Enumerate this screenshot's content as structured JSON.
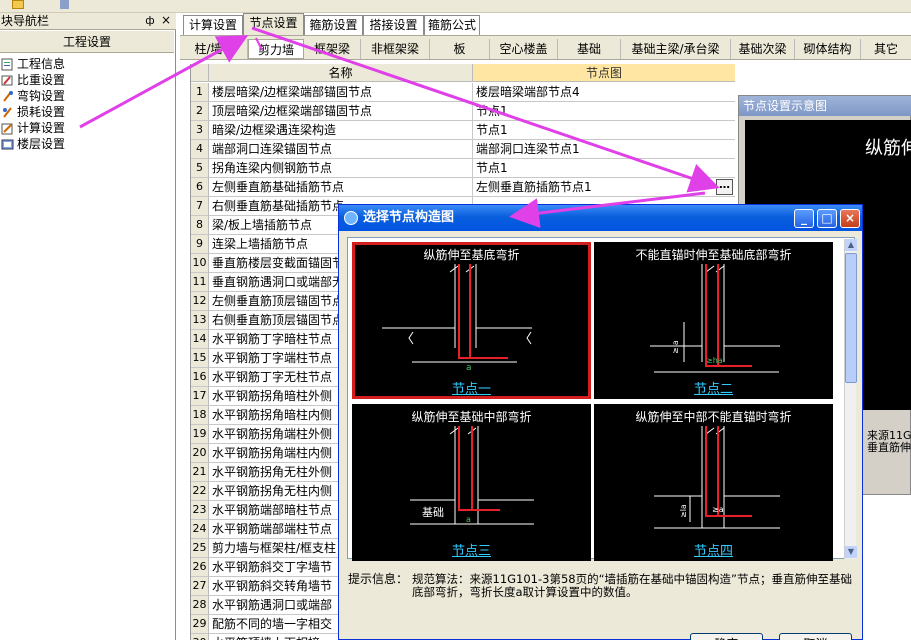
{
  "nav": {
    "title": "块导航栏",
    "pin": "ф",
    "close": "×",
    "section": "工程设置",
    "items": [
      {
        "label": "工程信息",
        "icon": "info-icon"
      },
      {
        "label": "比重设置",
        "icon": "ratio-icon"
      },
      {
        "label": "弯钩设置",
        "icon": "hook-icon"
      },
      {
        "label": "损耗设置",
        "icon": "loss-icon"
      },
      {
        "label": "计算设置",
        "icon": "calc-icon"
      },
      {
        "label": "楼层设置",
        "icon": "floor-icon"
      }
    ]
  },
  "tabs": [
    {
      "label": "计算设置"
    },
    {
      "label": "节点设置"
    },
    {
      "label": "箍筋设置"
    },
    {
      "label": "搭接设置"
    },
    {
      "label": "箍筋公式"
    }
  ],
  "subtabs": [
    {
      "label": "柱/墙柱"
    },
    {
      "label": "剪力墙"
    },
    {
      "label": "框架梁"
    },
    {
      "label": "非框架梁"
    },
    {
      "label": "板"
    },
    {
      "label": "空心楼盖"
    },
    {
      "label": "基础"
    },
    {
      "label": "基础主梁/承台梁"
    },
    {
      "label": "基础次梁"
    },
    {
      "label": "砌体结构"
    },
    {
      "label": "其它"
    }
  ],
  "grid": {
    "headers": {
      "name": "名称",
      "node": "节点图"
    },
    "rows": [
      {
        "num": "1",
        "name": "楼层暗梁/边框梁端部锚固节点",
        "node": "楼层暗梁端部节点4"
      },
      {
        "num": "2",
        "name": "顶层暗梁/边框梁端部锚固节点",
        "node": "节点1"
      },
      {
        "num": "3",
        "name": "暗梁/边框梁遇连梁构造",
        "node": "节点1"
      },
      {
        "num": "4",
        "name": "端部洞口连梁锚固节点",
        "node": "端部洞口连梁节点1"
      },
      {
        "num": "5",
        "name": "拐角连梁内侧钢筋节点",
        "node": "节点1"
      },
      {
        "num": "6",
        "name": "左侧垂直筋基础插筋节点",
        "node": "左侧垂直筋插筋节点1"
      },
      {
        "num": "7",
        "name": "右侧垂直筋基础插筋节点",
        "node": ""
      },
      {
        "num": "8",
        "name": "梁/板上墙插筋节点",
        "node": ""
      },
      {
        "num": "9",
        "name": "连梁上墙插筋节点",
        "node": ""
      },
      {
        "num": "10",
        "name": "垂直筋楼层变截面锚固节",
        "node": ""
      },
      {
        "num": "11",
        "name": "垂直钢筋遇洞口或端部无",
        "node": ""
      },
      {
        "num": "12",
        "name": "左侧垂直筋顶层锚固节点",
        "node": ""
      },
      {
        "num": "13",
        "name": "右侧垂直筋顶层锚固节点",
        "node": ""
      },
      {
        "num": "14",
        "name": "水平钢筋丁字暗柱节点",
        "node": ""
      },
      {
        "num": "15",
        "name": "水平钢筋丁字端柱节点",
        "node": ""
      },
      {
        "num": "16",
        "name": "水平钢筋丁字无柱节点",
        "node": ""
      },
      {
        "num": "17",
        "name": "水平钢筋拐角暗柱外侧",
        "node": ""
      },
      {
        "num": "18",
        "name": "水平钢筋拐角暗柱内侧",
        "node": ""
      },
      {
        "num": "19",
        "name": "水平钢筋拐角端柱外侧",
        "node": ""
      },
      {
        "num": "20",
        "name": "水平钢筋拐角端柱内侧",
        "node": ""
      },
      {
        "num": "21",
        "name": "水平钢筋拐角无柱外侧",
        "node": ""
      },
      {
        "num": "22",
        "name": "水平钢筋拐角无柱内侧",
        "node": ""
      },
      {
        "num": "23",
        "name": "水平钢筋端部暗柱节点",
        "node": ""
      },
      {
        "num": "24",
        "name": "水平钢筋端部端柱节点",
        "node": ""
      },
      {
        "num": "25",
        "name": "剪力墙与框架柱/框支柱",
        "node": ""
      },
      {
        "num": "26",
        "name": "水平钢筋斜交丁字墙节",
        "node": ""
      },
      {
        "num": "27",
        "name": "水平钢筋斜交转角墙节",
        "node": ""
      },
      {
        "num": "28",
        "name": "水平钢筋遇洞口或端部",
        "node": ""
      },
      {
        "num": "29",
        "name": "配筋不同的墙一字相交",
        "node": ""
      },
      {
        "num": "30",
        "name": "水平筋顶墙上下相接",
        "node": ""
      }
    ],
    "ellipsis": "…"
  },
  "preview": {
    "title": "节点设置示意图",
    "heading": "纵筋伸",
    "source_line1": "来源11G",
    "source_line2": "垂直筋伸"
  },
  "dialog": {
    "title": "选择节点构造图",
    "minimize": "_",
    "maximize": "□",
    "close": "×",
    "options": [
      {
        "caption": "纵筋伸至基底弯折",
        "label": "节点一",
        "selected": true
      },
      {
        "caption": "不能直锚时伸至基础底部弯折",
        "label": "节点二",
        "selected": false
      },
      {
        "caption": "纵筋伸至基础中部弯折",
        "label": "节点三",
        "selected": false
      },
      {
        "caption": "纵筋伸至中部不能直锚时弯折",
        "label": "节点四",
        "selected": false
      }
    ],
    "diagram_texts": {
      "a": "a",
      "la": "≥la",
      "ha": "≥ha",
      "base": "基础",
      "ge_a": "≥a"
    },
    "hint_label": "提示信息：",
    "hint_text": "规范算法：来源11G101-3第58页的“墙插筋在基础中锚固构造”节点；垂直筋伸至基础底部弯折，弯折长度a取计算设置中的数值。",
    "ok": "确定",
    "cancel": "取消"
  },
  "colors": {
    "arrow": "#e040e8",
    "selected_border": "#d21e1e",
    "rebar": "#e8202a",
    "node_label": "#33ccff"
  }
}
